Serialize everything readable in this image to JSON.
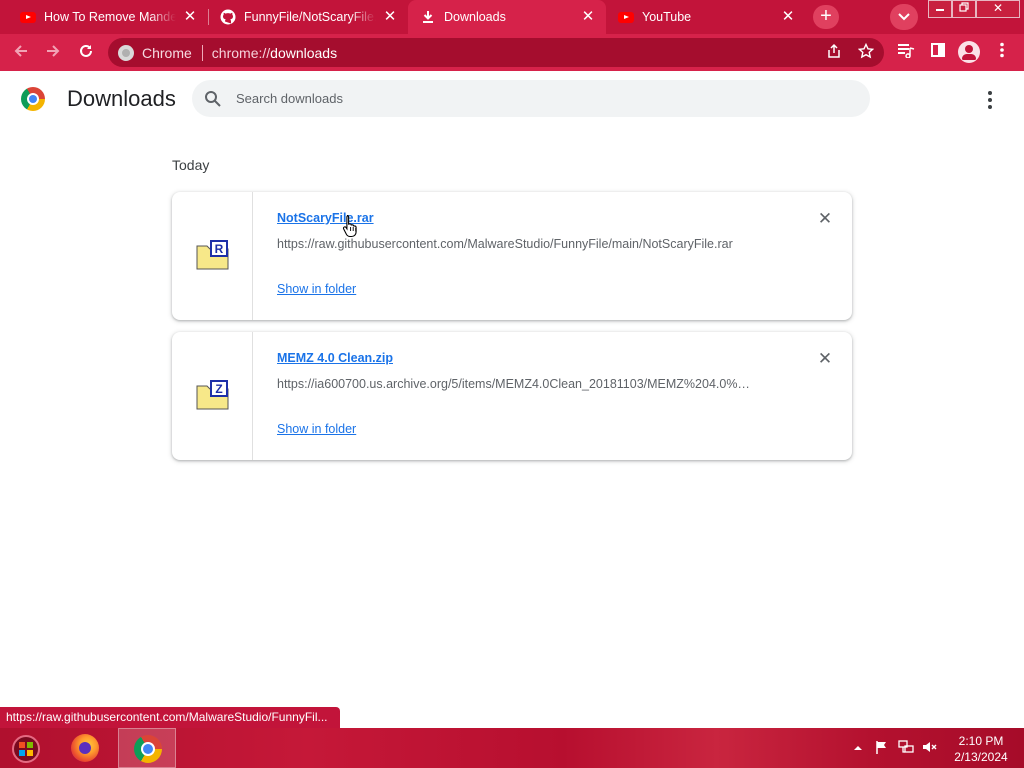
{
  "tabs": [
    {
      "title": "How To Remove Mandela",
      "icon": "youtube-icon",
      "active": false
    },
    {
      "title": "FunnyFile/NotScaryFile.rar",
      "icon": "github-icon",
      "active": false
    },
    {
      "title": "Downloads",
      "icon": "download-icon",
      "active": true
    },
    {
      "title": "YouTube",
      "icon": "youtube-icon",
      "active": false
    }
  ],
  "omnibox": {
    "site_label": "Chrome",
    "url_scheme": "chrome://",
    "url_host": "downloads"
  },
  "page": {
    "title": "Downloads",
    "search_placeholder": "Search downloads",
    "section_label": "Today"
  },
  "downloads": [
    {
      "file_name": "NotScaryFile.rar",
      "url": "https://raw.githubusercontent.com/MalwareStudio/FunnyFile/main/NotScaryFile.rar",
      "action": "Show in folder",
      "icon_letter": "R"
    },
    {
      "file_name": "MEMZ 4.0 Clean.zip",
      "url": "https://ia600700.us.archive.org/5/items/MEMZ4.0Clean_20181103/MEMZ%204.0%…",
      "action": "Show in folder",
      "icon_letter": "Z"
    }
  ],
  "status_bubble": "https://raw.githubusercontent.com/MalwareStudio/FunnyFil...",
  "taskbar": {
    "time": "2:10 PM",
    "date": "2/13/2024"
  },
  "colors": {
    "theme": "#c2143a",
    "toolbar": "#d6224a",
    "link": "#1a73e8"
  }
}
